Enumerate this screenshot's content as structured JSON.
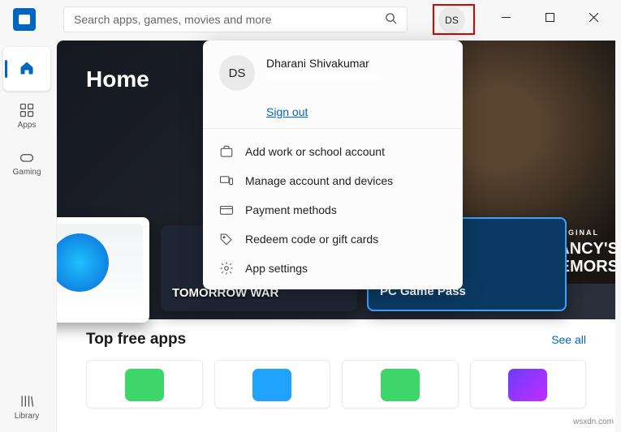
{
  "search": {
    "placeholder": "Search apps, games, movies and more"
  },
  "user": {
    "initials": "DS",
    "name": "Dharani Shivakumar",
    "sign_out": "Sign out"
  },
  "sidebar": {
    "items": [
      {
        "label": "",
        "key": "home"
      },
      {
        "label": "Apps",
        "key": "apps"
      },
      {
        "label": "Gaming",
        "key": "gaming"
      },
      {
        "label": "Library",
        "key": "library"
      }
    ]
  },
  "menu": {
    "add_account": "Add work or school account",
    "manage": "Manage account and devices",
    "payment": "Payment methods",
    "redeem": "Redeem code or gift cards",
    "settings": "App settings"
  },
  "hero": {
    "title": "Home",
    "tile_b": "TOMORROW WAR",
    "tile_c": "PC Game Pass",
    "banner_small": "AMAZON ORIGINAL",
    "banner_large_1": "OM CLANCY'S",
    "banner_large_2": "OUT REMORS"
  },
  "section": {
    "title": "Top free apps",
    "link": "See all"
  },
  "watermark": "wsxdn.com"
}
